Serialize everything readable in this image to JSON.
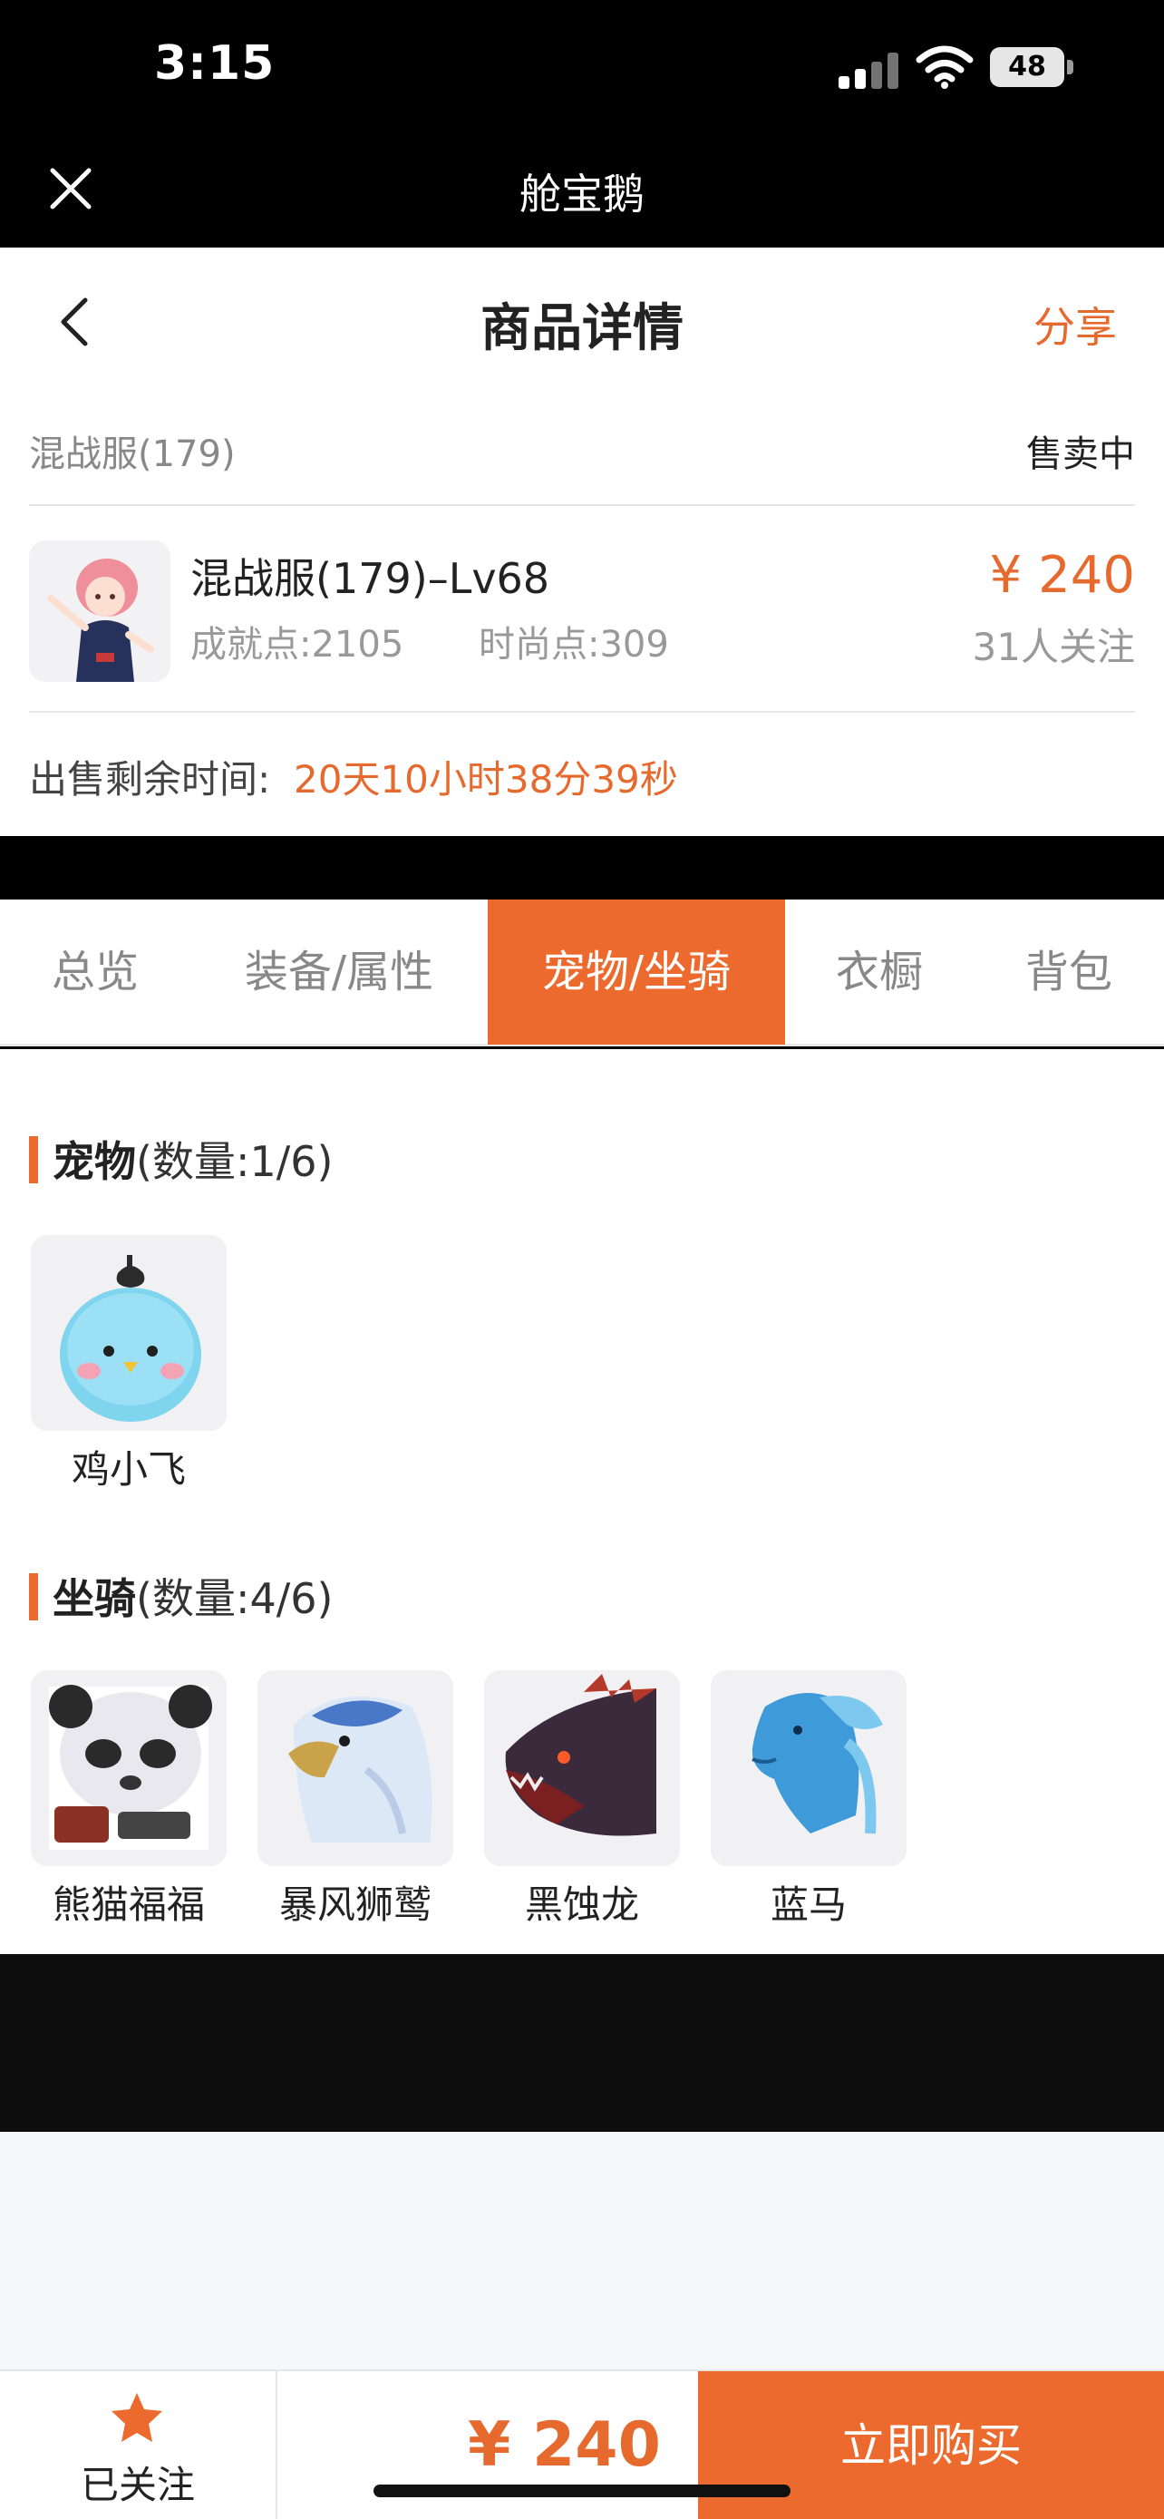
{
  "status_bar": {
    "time": "3:15",
    "battery": "48"
  },
  "app_bar": {
    "title": "舱宝鹅"
  },
  "page_header": {
    "title": "商品详情",
    "share_label": "分享"
  },
  "server": {
    "name": "混战服(179)",
    "status": "售卖中"
  },
  "item": {
    "title": "混战服(179)–Lv68",
    "achievement": "成就点:2105",
    "fashion": "时尚点:309",
    "price": "¥ 240",
    "followers": "31人关注"
  },
  "remaining": {
    "label": "出售剩余时间:",
    "value": "20天10小时38分39秒"
  },
  "tabs": [
    {
      "label": "总览",
      "active": false
    },
    {
      "label": "装备/属性",
      "active": false
    },
    {
      "label": "宠物/坐骑",
      "active": true
    },
    {
      "label": "衣橱",
      "active": false
    },
    {
      "label": "背包",
      "active": false
    }
  ],
  "pets": {
    "title": "宠物",
    "count": "(数量:1/6)",
    "items": [
      {
        "name": "鸡小飞"
      }
    ]
  },
  "mounts": {
    "title": "坐骑",
    "count": "(数量:4/6)",
    "items": [
      {
        "name": "熊猫福福"
      },
      {
        "name": "暴风狮鹫"
      },
      {
        "name": "黑蚀龙"
      },
      {
        "name": "蓝马"
      }
    ]
  },
  "bottom_bar": {
    "follow_label": "已关注",
    "price": "¥ 240",
    "buy_label": "立即购买"
  },
  "colors": {
    "accent": "#ec6a2e",
    "price": "#e6692d"
  }
}
